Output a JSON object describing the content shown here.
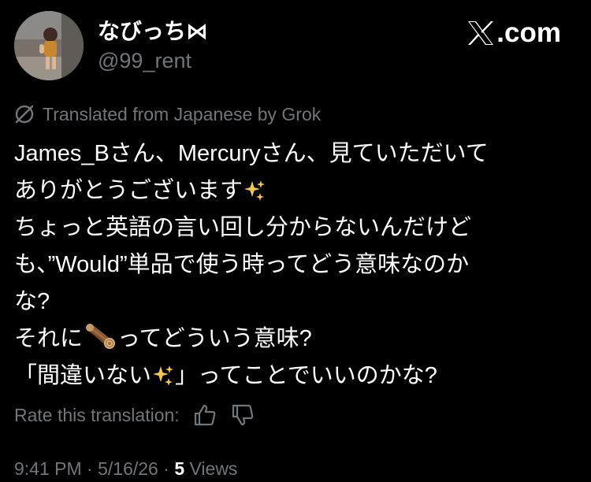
{
  "author": {
    "display_name": "なびっち⋈",
    "handle": "@99_rent"
  },
  "brand": {
    "logo_text": ".com"
  },
  "translation": {
    "label": "Translated from Japanese by Grok"
  },
  "tweet": {
    "lines": [
      "James_Bさん、Mercuryさん、見ていただいて",
      "ありがとうございます",
      "ちょっと英語の言い回し分からないんだけど",
      "も、”Would”単品で使う時ってどう意味なのか",
      "な?",
      "それに",
      "ってどういう意味?",
      "「間違いない",
      "」ってことでいいのかな?"
    ],
    "emojis": [
      "sparkles",
      "wood-log",
      "sparkles"
    ]
  },
  "rating": {
    "label": "Rate this translation:",
    "up_icon": "thumbs-up-icon",
    "down_icon": "thumbs-down-icon"
  },
  "meta": {
    "time": "9:41 PM",
    "date": "5/16/26",
    "sep": "·",
    "views_count": "5",
    "views_label": "Views"
  },
  "colors": {
    "background": "#000000",
    "text": "#ffffff",
    "muted": "#71767b",
    "sparkle": "#f7c948"
  }
}
